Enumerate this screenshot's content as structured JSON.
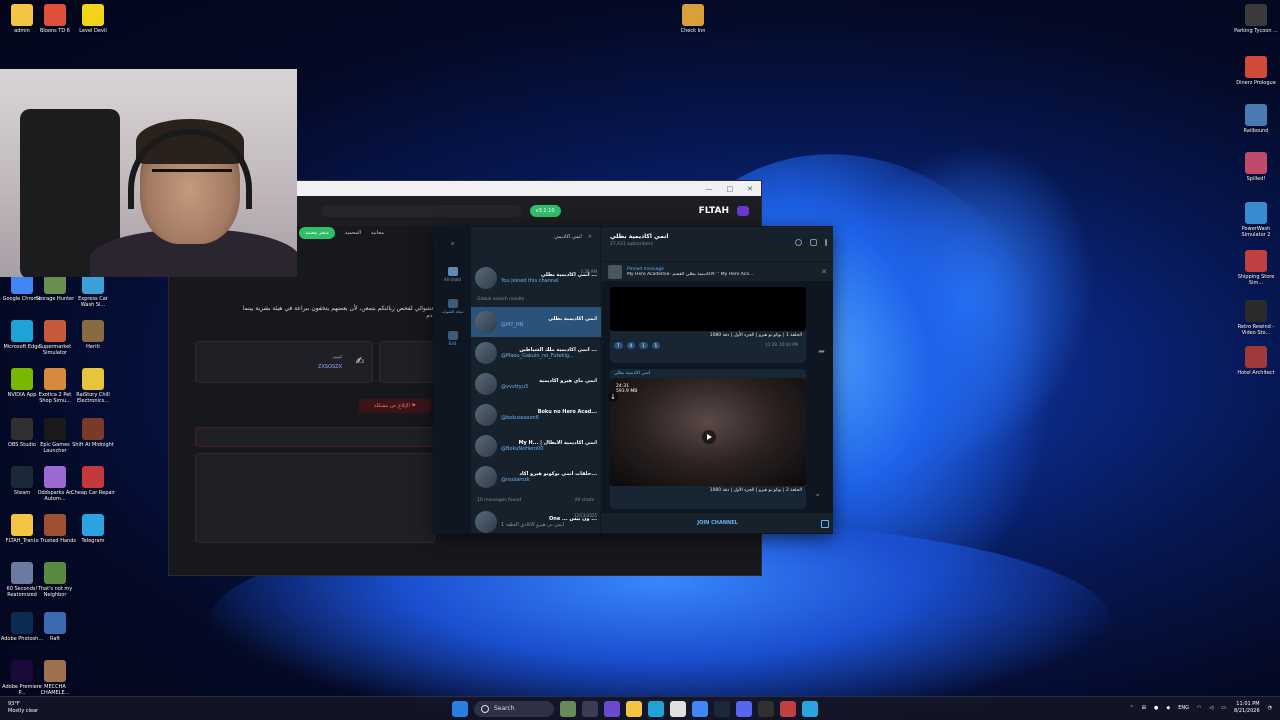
{
  "desktop": {
    "left_icons": [
      {
        "label": "admin",
        "color": "#f4c542"
      },
      {
        "label": "Bloons TD 6",
        "color": "#e0503c"
      },
      {
        "label": "Level Devil",
        "color": "#f2d21b"
      },
      {
        "label": "Google Chrome",
        "color": "#4285f4"
      },
      {
        "label": "Storage Hunter",
        "color": "#6b8e4e"
      },
      {
        "label": "Express Car Wash Si...",
        "color": "#3aa0d8"
      },
      {
        "label": "Microsoft Edge",
        "color": "#1fa3d6"
      },
      {
        "label": "Supermarket Simulator",
        "color": "#c85a3a"
      },
      {
        "label": "Heriti",
        "color": "#8a6a40"
      },
      {
        "label": "NVIDIA App",
        "color": "#76b900"
      },
      {
        "label": "Exotica 2 Pet Shop Simu...",
        "color": "#d88a3c"
      },
      {
        "label": "RaiStory Chill Electronics...",
        "color": "#e7c43a"
      },
      {
        "label": "OBS Studio",
        "color": "#303030"
      },
      {
        "label": "Epic Games Launcher",
        "color": "#1a1a1a"
      },
      {
        "label": "Shift At Midnight",
        "color": "#7a3a2a"
      },
      {
        "label": "Steam",
        "color": "#1b2838"
      },
      {
        "label": "Oddsparks An Autom...",
        "color": "#9a6ad0"
      },
      {
        "label": "Cheap Car Repair",
        "color": "#c43a3a"
      },
      {
        "label": "FLTAH_Tran...",
        "color": "#f4c542"
      },
      {
        "label": "In Trusted Hands",
        "color": "#a05030"
      },
      {
        "label": "Telegram",
        "color": "#2aa3e0"
      },
      {
        "label": "60 Seconds! Reatomized",
        "color": "#6a7aa0"
      },
      {
        "label": "That's not my Neighbor",
        "color": "#5a8a40"
      },
      {
        "label": "Adobe Photosh...",
        "color": "#0c2a52"
      },
      {
        "label": "Raft",
        "color": "#3a6ab0"
      },
      {
        "label": "Adobe Premiere P...",
        "color": "#1a0a3a"
      },
      {
        "label": "MECCHA CHAMELE...",
        "color": "#a07050"
      }
    ],
    "top_icon": {
      "label": "Check Inn",
      "color": "#d8a03a"
    },
    "right_icons": [
      {
        "label": "Parking Tycoon ...",
        "color": "#3a3a3a"
      },
      {
        "label": "Dinerz Prologue",
        "color": "#d04a3a"
      },
      {
        "label": "Railbound",
        "color": "#4a7ab0"
      },
      {
        "label": "Spilled!",
        "color": "#c04a6a"
      },
      {
        "label": "PowerWash Simulator 2",
        "color": "#3a8ad0"
      },
      {
        "label": "Shipping Store Sim...",
        "color": "#c04040"
      },
      {
        "label": "Retro Rewind - Video Sto...",
        "color": "#2a2a2a"
      },
      {
        "label": "Hotel Architect",
        "color": "#a03a3a"
      }
    ]
  },
  "browser": {
    "logo": "FLTAH",
    "version_badge": "v3.1.10",
    "buttons": [
      "متجر معتمد",
      "المحمية",
      "مجانية"
    ],
    "body_text": "عشوائي لفحص زبائنكم بتمعن، لأن بعضهم يتخفون ببراعة في هيئة بشرية بينما",
    "body_text_2": "دم!",
    "coupon_label": "كوبون",
    "coupon_code": "ZXSOSZX",
    "report_button": "الإبلاغ عن مشكلة"
  },
  "telegram": {
    "rail": {
      "all_chats": "All chats",
      "folder": "مجلد القنوات",
      "edit": "Edit"
    },
    "search_value": "انمي اكاديمي",
    "top_chat": {
      "title": "انمي اكاديمية بطلي ...",
      "subtitle": "You joined this channel",
      "time": "1:28 AM"
    },
    "global_label": "Global search results",
    "results": [
      {
        "title": "انمي اكاديمية بطلي",
        "handle": "@MY_HN"
      },
      {
        "title": "انمي اكاديمية ملك الشياطين ...",
        "handle": "@Maou_Gakuin_no_Futekig..."
      },
      {
        "title": "انمي ماي هيرو اكاديمية",
        "handle": "@vvvttyu3"
      },
      {
        "title": "Boku no Hero Acad...",
        "handle": "@bokuseason6"
      },
      {
        "title": "My H... | انمي اكاديمية الابطال",
        "handle": "@BokuNoHero00"
      },
      {
        "title": "حلقات انمي بوكونو هيرو اكاد...",
        "handle": "@nsolamzk"
      }
    ],
    "messages_found": "10 messages found",
    "all_chats_label": "All chats",
    "message_result": {
      "title": "One ... ون بيس ...",
      "subtitle": "انمي بي هيرو الاكادي الحلقة 1",
      "date": "12/13/2025"
    },
    "chat": {
      "title": "انمي اكاديمية بطلي",
      "subscribers": "27,431 subscribers",
      "pinned_label": "Pinned message",
      "pinned_text": "My Hero Academia- الاكاديمية بطلي القسم: \" My Hero Aca...",
      "msg1_caption": "الحلقة 1 | بوكو نو هيرو | الجزء الأول | دقة 1080",
      "msg1_meta": "11:29, 10:44 PM",
      "msg1_reactions": [
        "7",
        "4",
        "1",
        "1"
      ],
      "sender": "انمي اكاديمية بطلي",
      "video_duration": "24:31",
      "video_size": "593.9 MB",
      "msg2_caption": "الحلقة 2 | بوكو نو هيرو | الجزء الأول | دقة 1080",
      "join_button": "JOIN CHANNEL"
    }
  },
  "taskbar": {
    "temperature": "93°F",
    "weather": "Mostly clear",
    "search_label": "Search",
    "language": "ENG",
    "time": "11:01 PM",
    "date": "8/21/2026"
  }
}
